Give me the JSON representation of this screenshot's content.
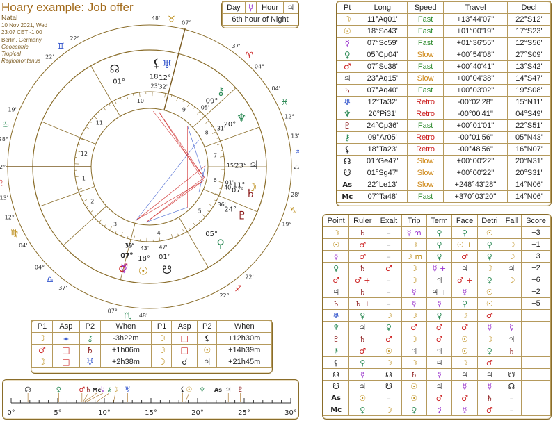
{
  "header": {
    "title": "Hoary example: Job offer",
    "type": "Natal",
    "date": "10 Nov 2021, Wed",
    "time": "23:07 CET -1:00",
    "place": "Berlin, Germany",
    "zodiac": "Geocentric",
    "tropical": "Tropical",
    "house_system": "Regiomontanus"
  },
  "day_hour": {
    "day_label": "Day",
    "day_planet": "☿",
    "hour_label": "Hour",
    "hour_planet": "♃",
    "caption": "6th hour of Night"
  },
  "planet_table": {
    "headers": [
      "Pt",
      "Long",
      "Speed",
      "Travel",
      "Decl"
    ],
    "rows": [
      {
        "glyph": "☽",
        "color": "#b8860b",
        "long": "11°Aq01'",
        "speed": "Fast",
        "speed_class": "fast",
        "travel": "+13°44'07''",
        "decl": "22°S12'"
      },
      {
        "glyph": "☉",
        "color": "#b8860b",
        "long": "18°Sc43'",
        "speed": "Fast",
        "speed_class": "fast",
        "travel": "+01°00'19''",
        "decl": "17°S23'"
      },
      {
        "glyph": "☿",
        "color": "#9932cc",
        "long": "07°Sc59'",
        "speed": "Fast",
        "speed_class": "fast",
        "travel": "+01°36'55''",
        "decl": "12°S56'"
      },
      {
        "glyph": "♀",
        "color": "#2e8b57",
        "long": "05°Cp04'",
        "speed": "Slow",
        "speed_class": "slow",
        "travel": "+00°54'08''",
        "decl": "27°S09'"
      },
      {
        "glyph": "♂",
        "color": "#cc2222",
        "long": "07°Sc38'",
        "speed": "Fast",
        "speed_class": "fast",
        "travel": "+00°40'41''",
        "decl": "13°S42'"
      },
      {
        "glyph": "♃",
        "color": "#555555",
        "long": "23°Aq15'",
        "speed": "Slow",
        "speed_class": "slow",
        "travel": "+00°04'38''",
        "decl": "14°S47'"
      },
      {
        "glyph": "♄",
        "color": "#8b1a1a",
        "long": "07°Aq40'",
        "speed": "Fast",
        "speed_class": "fast",
        "travel": "+00°03'02''",
        "decl": "19°S08'"
      },
      {
        "glyph": "♅",
        "color": "#3355cc",
        "long": "12°Ta32'",
        "speed": "Retro",
        "speed_class": "retro",
        "travel": "-00°02'28''",
        "decl": "15°N11'"
      },
      {
        "glyph": "♆",
        "color": "#2e8b57",
        "long": "20°Pi31'",
        "speed": "Retro",
        "speed_class": "retro",
        "travel": "-00°00'41''",
        "decl": "04°S49'"
      },
      {
        "glyph": "♇",
        "color": "#8b1a1a",
        "long": "24°Cp36'",
        "speed": "Fast",
        "speed_class": "fast",
        "travel": "+00°01'01''",
        "decl": "22°S51'"
      },
      {
        "glyph": "⚷",
        "color": "#2e8b57",
        "long": "09°Ar05'",
        "speed": "Retro",
        "speed_class": "retro",
        "travel": "-00°01'56''",
        "decl": "05°N43'"
      },
      {
        "glyph": "⚸",
        "color": "#222222",
        "long": "18°Ta23'",
        "speed": "Retro",
        "speed_class": "retro",
        "travel": "-00°48'56''",
        "decl": "16°N07'"
      },
      {
        "glyph": "☊",
        "color": "#222222",
        "long": "01°Ge47'",
        "speed": "Slow",
        "speed_class": "slow",
        "travel": "+00°00'22''",
        "decl": "20°N31'"
      },
      {
        "glyph": "☋",
        "color": "#222222",
        "long": "01°Sg47'",
        "speed": "Slow",
        "speed_class": "slow",
        "travel": "+00°00'22''",
        "decl": "20°S31'"
      },
      {
        "glyph": "As",
        "color": "#222222",
        "long": "22°Le13'",
        "speed": "Slow",
        "speed_class": "slow",
        "travel": "+248°43'28''",
        "decl": "14°N06'"
      },
      {
        "glyph": "Mc",
        "color": "#222222",
        "long": "07°Ta48'",
        "speed": "Fast",
        "speed_class": "fast",
        "travel": "+370°03'20''",
        "decl": "14°N06'"
      }
    ]
  },
  "dignity_table": {
    "headers": [
      "Point",
      "Ruler",
      "Exalt",
      "Trip",
      "Term",
      "Face",
      "Detri",
      "Fall",
      "Score"
    ],
    "rows": [
      {
        "point": "☽",
        "pc": "#b8860b",
        "c": [
          [
            "♄",
            "#8b1a1a"
          ],
          [
            "–",
            "#aaa"
          ],
          [
            "☿ m",
            "#9932cc"
          ],
          [
            "♀",
            "#2e8b57"
          ],
          [
            "♀",
            "#2e8b57"
          ],
          [
            "☉",
            "#b8860b"
          ],
          [
            "",
            ""
          ]
        ],
        "score": "+3"
      },
      {
        "point": "☉",
        "pc": "#b8860b",
        "c": [
          [
            "♂",
            "#cc2222"
          ],
          [
            "–",
            "#aaa"
          ],
          [
            "☽",
            "#b8860b"
          ],
          [
            "♀",
            "#2e8b57"
          ],
          [
            "☉ +",
            "#b8860b"
          ],
          [
            "♀",
            "#2e8b57"
          ],
          [
            "☽",
            "#b8860b"
          ]
        ],
        "score": "+1"
      },
      {
        "point": "☿",
        "pc": "#9932cc",
        "c": [
          [
            "♂",
            "#cc2222"
          ],
          [
            "–",
            "#aaa"
          ],
          [
            "☽ m",
            "#b8860b"
          ],
          [
            "♀",
            "#2e8b57"
          ],
          [
            "♂",
            "#cc2222"
          ],
          [
            "♀",
            "#2e8b57"
          ],
          [
            "☽",
            "#b8860b"
          ]
        ],
        "score": "+3"
      },
      {
        "point": "♀",
        "pc": "#2e8b57",
        "c": [
          [
            "♄",
            "#8b1a1a"
          ],
          [
            "♂",
            "#cc2222"
          ],
          [
            "☽",
            "#b8860b"
          ],
          [
            "☿ +",
            "#9932cc"
          ],
          [
            "♃",
            "#555555"
          ],
          [
            "☽",
            "#b8860b"
          ],
          [
            "♃",
            "#555555"
          ]
        ],
        "score": "+2"
      },
      {
        "point": "♂",
        "pc": "#cc2222",
        "c": [
          [
            "♂ +",
            "#cc2222"
          ],
          [
            "–",
            "#aaa"
          ],
          [
            "☽",
            "#b8860b"
          ],
          [
            "♃",
            "#555555"
          ],
          [
            "♂ +",
            "#cc2222"
          ],
          [
            "♀",
            "#2e8b57"
          ],
          [
            "☽",
            "#b8860b"
          ]
        ],
        "score": "+6"
      },
      {
        "point": "♃",
        "pc": "#555555",
        "c": [
          [
            "♄",
            "#8b1a1a"
          ],
          [
            "–",
            "#aaa"
          ],
          [
            "☿",
            "#9932cc"
          ],
          [
            "♃ +",
            "#555555"
          ],
          [
            "☿",
            "#9932cc"
          ],
          [
            "☉",
            "#b8860b"
          ],
          [
            "",
            ""
          ]
        ],
        "score": "+2"
      },
      {
        "point": "♄",
        "pc": "#8b1a1a",
        "c": [
          [
            "♄ +",
            "#8b1a1a"
          ],
          [
            "–",
            "#aaa"
          ],
          [
            "☿",
            "#9932cc"
          ],
          [
            "☿",
            "#9932cc"
          ],
          [
            "♀",
            "#2e8b57"
          ],
          [
            "☉",
            "#b8860b"
          ],
          [
            "",
            ""
          ]
        ],
        "score": "+5"
      },
      {
        "point": "♅",
        "pc": "#3355cc",
        "c": [
          [
            "♀",
            "#2e8b57"
          ],
          [
            "☽",
            "#b8860b"
          ],
          [
            "☽",
            "#b8860b"
          ],
          [
            "♀",
            "#2e8b57"
          ],
          [
            "☽",
            "#b8860b"
          ],
          [
            "♂",
            "#cc2222"
          ],
          [
            "",
            ""
          ]
        ],
        "score": ""
      },
      {
        "point": "♆",
        "pc": "#2e8b57",
        "c": [
          [
            "♃",
            "#555555"
          ],
          [
            "♀",
            "#2e8b57"
          ],
          [
            "♂",
            "#cc2222"
          ],
          [
            "♂",
            "#cc2222"
          ],
          [
            "♂",
            "#cc2222"
          ],
          [
            "☿",
            "#9932cc"
          ],
          [
            "☿",
            "#9932cc"
          ]
        ],
        "score": ""
      },
      {
        "point": "♇",
        "pc": "#8b1a1a",
        "c": [
          [
            "♄",
            "#8b1a1a"
          ],
          [
            "♂",
            "#cc2222"
          ],
          [
            "☽",
            "#b8860b"
          ],
          [
            "♂",
            "#cc2222"
          ],
          [
            "☉",
            "#b8860b"
          ],
          [
            "☽",
            "#b8860b"
          ],
          [
            "♃",
            "#555555"
          ]
        ],
        "score": ""
      },
      {
        "point": "⚷",
        "pc": "#2e8b57",
        "c": [
          [
            "♂",
            "#cc2222"
          ],
          [
            "☉",
            "#b8860b"
          ],
          [
            "♃",
            "#555555"
          ],
          [
            "♃",
            "#555555"
          ],
          [
            "☉",
            "#b8860b"
          ],
          [
            "♀",
            "#2e8b57"
          ],
          [
            "♄",
            "#8b1a1a"
          ]
        ],
        "score": ""
      },
      {
        "point": "⚸",
        "pc": "#222222",
        "c": [
          [
            "♀",
            "#2e8b57"
          ],
          [
            "☽",
            "#b8860b"
          ],
          [
            "☽",
            "#b8860b"
          ],
          [
            "♃",
            "#555555"
          ],
          [
            "☽",
            "#b8860b"
          ],
          [
            "♂",
            "#cc2222"
          ],
          [
            "",
            ""
          ]
        ],
        "score": ""
      },
      {
        "point": "☊",
        "pc": "#222222",
        "c": [
          [
            "☿",
            "#9932cc"
          ],
          [
            "☊",
            "#222222"
          ],
          [
            "♄",
            "#8b1a1a"
          ],
          [
            "☿",
            "#9932cc"
          ],
          [
            "♃",
            "#555555"
          ],
          [
            "♃",
            "#555555"
          ],
          [
            "☋",
            "#222222"
          ]
        ],
        "score": ""
      },
      {
        "point": "☋",
        "pc": "#222222",
        "c": [
          [
            "♃",
            "#555555"
          ],
          [
            "☋",
            "#222222"
          ],
          [
            "☉",
            "#b8860b"
          ],
          [
            "♃",
            "#555555"
          ],
          [
            "☿",
            "#9932cc"
          ],
          [
            "☿",
            "#9932cc"
          ],
          [
            "☊",
            "#222222"
          ]
        ],
        "score": ""
      },
      {
        "point": "As",
        "pc": "#222222",
        "c": [
          [
            "☉",
            "#b8860b"
          ],
          [
            "–",
            "#aaa"
          ],
          [
            "☉",
            "#b8860b"
          ],
          [
            "♂",
            "#cc2222"
          ],
          [
            "♂",
            "#cc2222"
          ],
          [
            "♄",
            "#8b1a1a"
          ],
          [
            "–",
            "#aaa"
          ]
        ],
        "score": ""
      },
      {
        "point": "Mc",
        "pc": "#222222",
        "c": [
          [
            "♀",
            "#2e8b57"
          ],
          [
            "☽",
            "#b8860b"
          ],
          [
            "♀",
            "#2e8b57"
          ],
          [
            "☿",
            "#9932cc"
          ],
          [
            "☿",
            "#9932cc"
          ],
          [
            "♂",
            "#cc2222"
          ],
          [
            "–",
            "#aaa"
          ]
        ],
        "score": ""
      }
    ]
  },
  "aspects_table": {
    "headers": [
      "P1",
      "Asp",
      "P2",
      "When"
    ],
    "left": [
      {
        "p1": "☽",
        "p1c": "#b8860b",
        "asp": "⚹",
        "aspc": "#3355cc",
        "p2": "⚷",
        "p2c": "#2e8b57",
        "when": "-3h22m"
      },
      {
        "p1": "♂",
        "p1c": "#cc2222",
        "asp": "□",
        "aspc": "#cc2222",
        "p2": "♄",
        "p2c": "#8b1a1a",
        "when": "+1h06m"
      },
      {
        "p1": "☽",
        "p1c": "#b8860b",
        "asp": "□",
        "aspc": "#cc2222",
        "p2": "♅",
        "p2c": "#3355cc",
        "when": "+2h38m"
      }
    ],
    "right": [
      {
        "p1": "☽",
        "p1c": "#b8860b",
        "asp": "□",
        "aspc": "#cc2222",
        "p2": "⚸",
        "p2c": "#222222",
        "when": "+12h30m"
      },
      {
        "p1": "☽",
        "p1c": "#b8860b",
        "asp": "□",
        "aspc": "#cc2222",
        "p2": "☉",
        "p2c": "#b8860b",
        "when": "+14h39m"
      },
      {
        "p1": "☽",
        "p1c": "#b8860b",
        "asp": "☌",
        "aspc": "#222222",
        "p2": "♃",
        "p2c": "#555555",
        "when": "+21h45m"
      }
    ]
  },
  "degree_strip": {
    "ticks": [
      "0°",
      "5°",
      "10°",
      "15°",
      "20°",
      "25°",
      "30°"
    ],
    "markers": [
      {
        "g": "☊",
        "c": "#222222",
        "deg": 1.8
      },
      {
        "g": "♀",
        "c": "#2e8b57",
        "deg": 5.1
      },
      {
        "g": "♂",
        "c": "#cc2222",
        "deg": 7.6
      },
      {
        "g": "♄",
        "c": "#8b1a1a",
        "deg": 7.7
      },
      {
        "g": "Mc",
        "c": "#222222",
        "deg": 7.8
      },
      {
        "g": "☿",
        "c": "#9932cc",
        "deg": 8.0
      },
      {
        "g": "⚷",
        "c": "#2e8b57",
        "deg": 9.1
      },
      {
        "g": "☽",
        "c": "#b8860b",
        "deg": 11.0
      },
      {
        "g": "♅",
        "c": "#3355cc",
        "deg": 12.5
      },
      {
        "g": "⚸",
        "c": "#222222",
        "deg": 18.4
      },
      {
        "g": "☉",
        "c": "#b8860b",
        "deg": 18.7
      },
      {
        "g": "♆",
        "c": "#2e8b57",
        "deg": 20.5
      },
      {
        "g": "As",
        "c": "#222222",
        "deg": 22.2
      },
      {
        "g": "♃",
        "c": "#555555",
        "deg": 23.3
      },
      {
        "g": "♇",
        "c": "#8b1a1a",
        "deg": 24.6
      }
    ]
  },
  "wheel": {
    "signs": [
      {
        "g": "♈",
        "c": "#cc2222"
      },
      {
        "g": "♉",
        "c": "#b8860b"
      },
      {
        "g": "♊",
        "c": "#3355cc"
      },
      {
        "g": "♋",
        "c": "#2e8b57"
      },
      {
        "g": "♌",
        "c": "#cc2222"
      },
      {
        "g": "♍",
        "c": "#b8860b"
      },
      {
        "g": "♎",
        "c": "#3355cc"
      },
      {
        "g": "♏",
        "c": "#2e8b57"
      },
      {
        "g": "♐",
        "c": "#cc2222"
      },
      {
        "g": "♑",
        "c": "#b8860b"
      },
      {
        "g": "♒",
        "c": "#3355cc"
      },
      {
        "g": "♓",
        "c": "#2e8b57"
      }
    ],
    "cusp_labels": [
      {
        "deg": "22°",
        "sign": "♌",
        "min": "13'",
        "c": "#cc2222"
      },
      {
        "deg": "12°",
        "sign": "♍",
        "min": "04'",
        "c": "#b8860b"
      },
      {
        "deg": "04°",
        "sign": "♎",
        "min": "37'",
        "c": "#3355cc"
      },
      {
        "deg": "07°",
        "sign": "♏",
        "min": "48'",
        "c": "#2e8b57"
      },
      {
        "deg": "22°",
        "sign": "♐",
        "min": "22'",
        "c": "#cc2222"
      },
      {
        "deg": "19°",
        "sign": "♑",
        "min": "28°",
        "c": "#b8860b"
      },
      {
        "deg": "22°",
        "sign": "♒",
        "min": "13'",
        "c": "#3355cc"
      },
      {
        "deg": "12°",
        "sign": "♓",
        "min": "04'",
        "c": "#2e8b57"
      },
      {
        "deg": "04°",
        "sign": "♈",
        "min": "37'",
        "c": "#cc2222"
      },
      {
        "deg": "07°",
        "sign": "♉",
        "min": "48'",
        "c": "#b8860b"
      },
      {
        "deg": "22°",
        "sign": "♊",
        "min": "22'",
        "c": "#3355cc"
      },
      {
        "deg": "19'",
        "sign": "♋",
        "min": "28°",
        "c": "#2e8b57"
      }
    ],
    "houses": [
      "1",
      "2",
      "3",
      "4",
      "5",
      "6",
      "7",
      "8",
      "9",
      "10",
      "11",
      "12"
    ],
    "planet_labels": [
      {
        "g": "☊",
        "c": "#222",
        "deg": "01°",
        "min": ""
      },
      {
        "g": "⚸",
        "c": "#222",
        "deg": "18°",
        "min": "23'"
      },
      {
        "g": "♅",
        "c": "#3355cc",
        "deg": "12°",
        "min": "32'"
      },
      {
        "g": "♀",
        "c": "#2e8b57",
        "deg": "05°",
        "min": ""
      },
      {
        "g": "♃",
        "c": "#555",
        "deg": "23°",
        "min": "15'"
      },
      {
        "g": "♆",
        "c": "#2e8b57",
        "deg": "20°",
        "min": "31'"
      },
      {
        "g": "⚷",
        "c": "#2e8b57",
        "deg": "09°",
        "min": "05'"
      },
      {
        "g": "☽",
        "c": "#b8860b",
        "deg": "11°",
        "min": "01'"
      },
      {
        "g": "♄",
        "c": "#8b1a1a",
        "deg": "07°",
        "min": "40'"
      },
      {
        "g": "♇",
        "c": "#8b1a1a",
        "deg": "24°",
        "min": "36'"
      },
      {
        "g": "☉",
        "c": "#b8860b",
        "deg": "18°",
        "min": "43'"
      },
      {
        "g": "♂",
        "c": "#cc2222",
        "deg": "07°",
        "min": "38'"
      },
      {
        "g": "☿",
        "c": "#9932cc",
        "deg": "07°",
        "min": "59'"
      },
      {
        "g": "☋",
        "c": "#222",
        "deg": "01°",
        "min": "47'"
      }
    ]
  }
}
